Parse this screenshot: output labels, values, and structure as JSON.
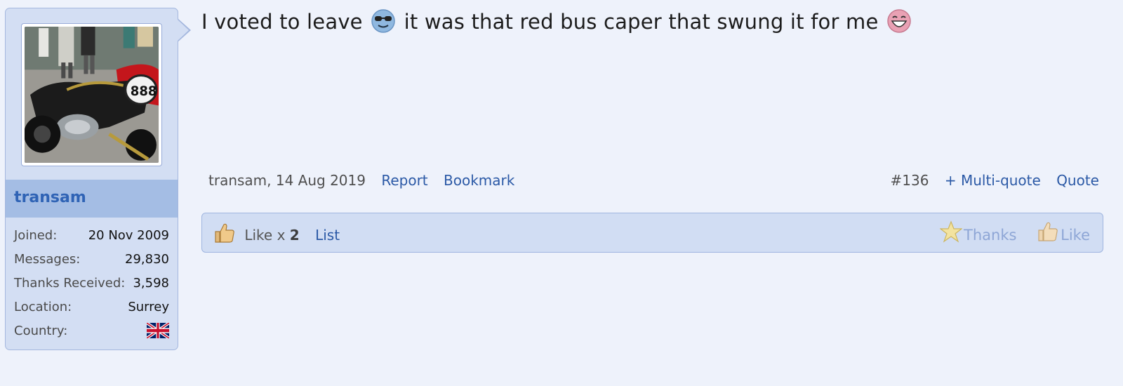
{
  "post": {
    "message": {
      "part1": "I voted to leave",
      "smiley1": "cool-sunglasses-smiley-icon",
      "part2": "it was that red bus caper that swung it for me",
      "smiley2": "laughing-smiley-icon"
    },
    "author": "transam",
    "author_date": "transam, 14 Aug 2019",
    "report_label": "Report",
    "bookmark_label": "Bookmark",
    "post_number": "#136",
    "multiquote_label": "+ Multi-quote",
    "quote_label": "Quote"
  },
  "user": {
    "name": "transam",
    "avatar": "motorcycle-avatar-icon",
    "stats": [
      {
        "label": "Joined:",
        "value": "20 Nov 2009"
      },
      {
        "label": "Messages:",
        "value": "29,830"
      },
      {
        "label": "Thanks Received:",
        "value": "3,598"
      },
      {
        "label": "Location:",
        "value": "Surrey"
      },
      {
        "label": "Country:",
        "value": "uk-flag-icon"
      }
    ]
  },
  "likes": {
    "summary_prefix": "Like x",
    "count": "2",
    "list_label": "List",
    "thanks_label": "Thanks",
    "like_label": "Like"
  },
  "colors": {
    "background": "#eef2fb",
    "sidebar": "#d3def3",
    "username_bar": "#a4bde4",
    "link": "#2b59a6",
    "username": "#2f63b5",
    "muted_action": "#8ea6d6"
  }
}
